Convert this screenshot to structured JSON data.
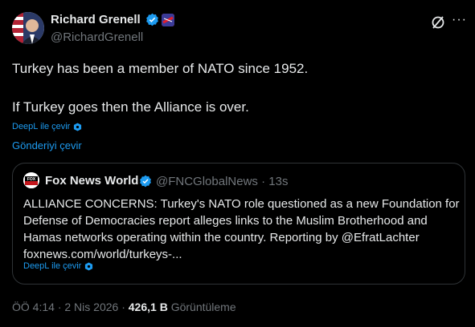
{
  "author": {
    "name": "Richard Grenell",
    "handle": "@RichardGrenell"
  },
  "tweet": {
    "line1": "Turkey has been a member of NATO since 1952.",
    "line2": "If Turkey goes then the Alliance is over.",
    "deepl_label": "DeepL ile çevir",
    "translate_label": "Gönderiyi çevir"
  },
  "quoted": {
    "name": "Fox News World",
    "handle": "@FNCGlobalNews",
    "separator": "·",
    "time": "13s",
    "text": "ALLIANCE CONCERNS: Turkey's NATO role questioned as a new Foundation for Defense of Democracies report alleges links to the Muslim Brotherhood and Hamas networks operating within the country. Reporting by @EfratLachter foxnews.com/world/turkeys-...",
    "deepl_label": "DeepL ile çevir"
  },
  "footer": {
    "time": "ÖÖ 4:14",
    "date": "2 Nis 2026",
    "views_count": "426,1 B",
    "views_label": "Görüntüleme",
    "sep": "·"
  },
  "colors": {
    "background": "#000000",
    "text": "#e7e9ea",
    "muted": "#71767b",
    "accent": "#1d9bf0",
    "border": "#2f3336"
  },
  "icons": [
    "avatar",
    "verified-badge-icon",
    "flag-icon",
    "grok-icon",
    "more-icon",
    "fox-news-logo",
    "deepl-icon"
  ]
}
